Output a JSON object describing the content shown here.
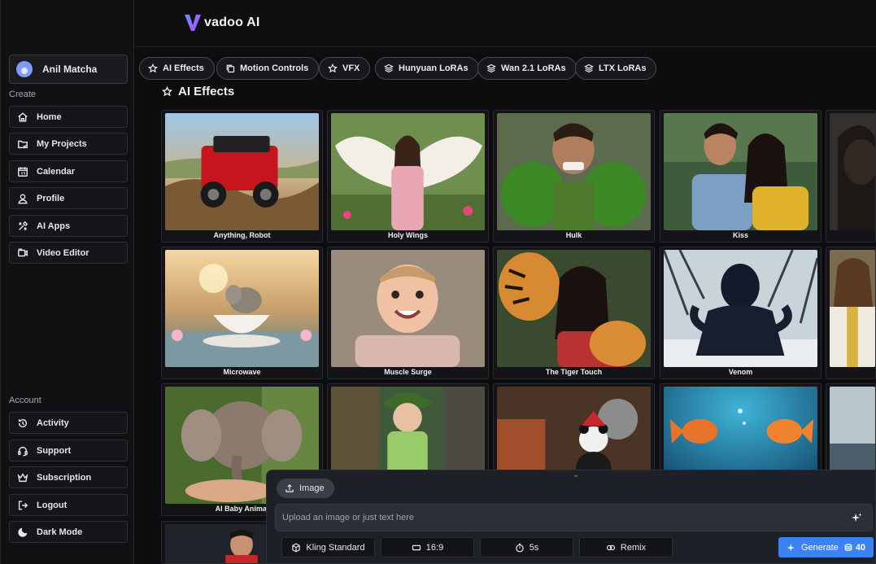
{
  "app": {
    "brand": "vadoo AI"
  },
  "user": {
    "name": "Anil Matcha"
  },
  "sidebar": {
    "create_label": "Create",
    "account_label": "Account",
    "create_items": [
      {
        "label": "Home",
        "icon": "home-icon"
      },
      {
        "label": "My Projects",
        "icon": "folder-icon"
      },
      {
        "label": "Calendar",
        "icon": "calendar-icon"
      },
      {
        "label": "Profile",
        "icon": "profile-icon"
      },
      {
        "label": "AI Apps",
        "icon": "tools-icon"
      },
      {
        "label": "Video Editor",
        "icon": "video-editor-icon"
      }
    ],
    "account_items": [
      {
        "label": "Activity",
        "icon": "history-icon"
      },
      {
        "label": "Support",
        "icon": "headset-icon"
      },
      {
        "label": "Subscription",
        "icon": "crown-icon"
      },
      {
        "label": "Logout",
        "icon": "logout-icon"
      },
      {
        "label": "Dark Mode",
        "icon": "moon-icon"
      }
    ]
  },
  "tabs": [
    {
      "label": "AI Effects",
      "icon": "star-icon"
    },
    {
      "label": "Motion Controls",
      "icon": "copy-icon"
    },
    {
      "label": "VFX",
      "icon": "star-icon"
    },
    {
      "label": "Hunyuan LoRAs",
      "icon": "layers-icon"
    },
    {
      "label": "Wan 2.1 LoRAs",
      "icon": "layers-icon"
    },
    {
      "label": "LTX LoRAs",
      "icon": "layers-icon"
    }
  ],
  "section": {
    "title": "AI Effects"
  },
  "effects": [
    "Anything, Robot",
    "Holy Wings",
    "Hulk",
    "Kiss",
    "",
    "Microwave",
    "Muscle Surge",
    "The Tiger Touch",
    "Venom",
    "",
    "AI Baby Animal",
    "",
    "",
    "",
    ""
  ],
  "composer": {
    "image_label": "Image",
    "placeholder": "Upload an image or just text here",
    "model": "Kling Standard",
    "aspect": "16:9",
    "duration": "5s",
    "remix": "Remix",
    "generate": "Generate",
    "credits": "40"
  },
  "colors": {
    "accent": "#3b82f6",
    "annotation_arrow": "#e53935"
  }
}
